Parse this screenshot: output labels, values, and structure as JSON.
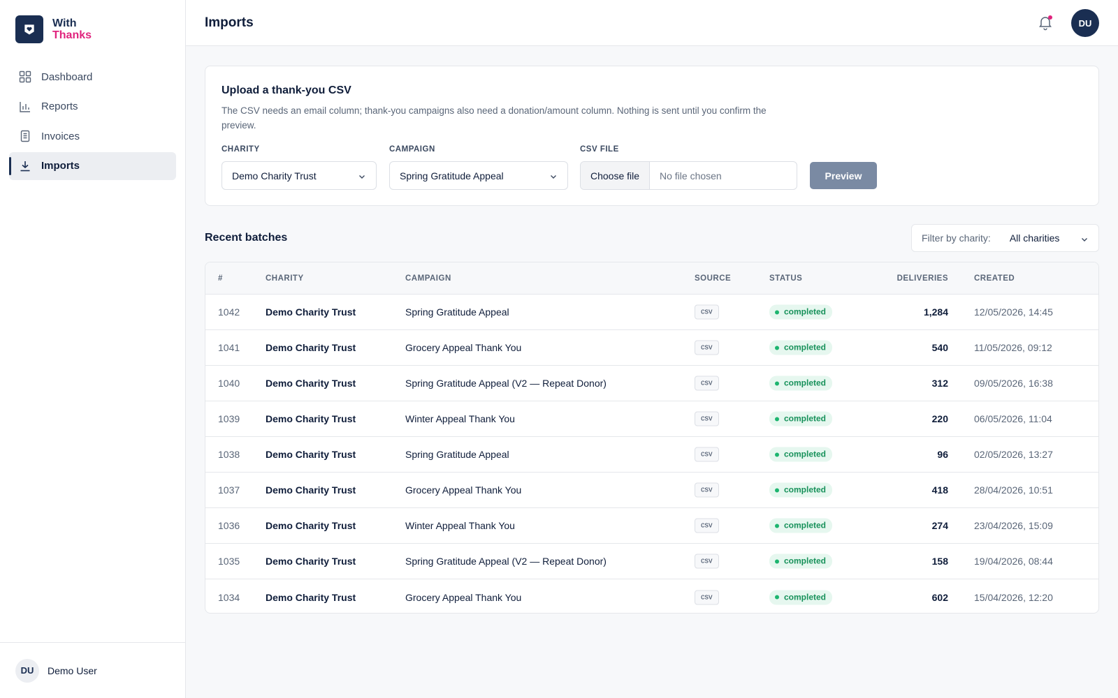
{
  "brand": {
    "line1": "With",
    "line2": "Thanks",
    "icon": "heart-icon"
  },
  "sidebar": {
    "items": [
      {
        "label": "Dashboard",
        "icon": "grid-icon",
        "active": false
      },
      {
        "label": "Reports",
        "icon": "bar-chart-icon",
        "active": false
      },
      {
        "label": "Invoices",
        "icon": "document-icon",
        "active": false
      },
      {
        "label": "Imports",
        "icon": "download-icon",
        "active": true
      }
    ],
    "user": {
      "initials": "DU",
      "name": "Demo User"
    }
  },
  "header": {
    "title": "Imports",
    "avatar_initials": "DU"
  },
  "upload": {
    "title": "Upload a thank-you CSV",
    "description": "The CSV needs an email column; thank-you campaigns also need a donation/amount column. Nothing is sent until you confirm the preview.",
    "charity_label": "CHARITY",
    "charity_value": "Demo Charity Trust",
    "campaign_label": "CAMPAIGN",
    "campaign_value": "Spring Gratitude Appeal",
    "file_label": "CSV FILE",
    "file_button": "Choose file",
    "file_status": "No file chosen",
    "preview_button": "Preview"
  },
  "batches": {
    "title": "Recent batches",
    "filter_label": "Filter by charity:",
    "filter_value": "All charities",
    "columns": {
      "id": "#",
      "charity": "CHARITY",
      "campaign": "CAMPAIGN",
      "source": "SOURCE",
      "status": "STATUS",
      "deliveries": "DELIVERIES",
      "created": "CREATED"
    },
    "rows": [
      {
        "id": "1042",
        "charity": "Demo Charity Trust",
        "campaign": "Spring Gratitude Appeal",
        "source": "csv",
        "status": "completed",
        "deliveries": "1,284",
        "created": "12/05/2026, 14:45"
      },
      {
        "id": "1041",
        "charity": "Demo Charity Trust",
        "campaign": "Grocery Appeal Thank You",
        "source": "csv",
        "status": "completed",
        "deliveries": "540",
        "created": "11/05/2026, 09:12"
      },
      {
        "id": "1040",
        "charity": "Demo Charity Trust",
        "campaign": "Spring Gratitude Appeal (V2 — Repeat Donor)",
        "source": "csv",
        "status": "completed",
        "deliveries": "312",
        "created": "09/05/2026, 16:38"
      },
      {
        "id": "1039",
        "charity": "Demo Charity Trust",
        "campaign": "Winter Appeal Thank You",
        "source": "csv",
        "status": "completed",
        "deliveries": "220",
        "created": "06/05/2026, 11:04"
      },
      {
        "id": "1038",
        "charity": "Demo Charity Trust",
        "campaign": "Spring Gratitude Appeal",
        "source": "csv",
        "status": "completed",
        "deliveries": "96",
        "created": "02/05/2026, 13:27"
      },
      {
        "id": "1037",
        "charity": "Demo Charity Trust",
        "campaign": "Grocery Appeal Thank You",
        "source": "csv",
        "status": "completed",
        "deliveries": "418",
        "created": "28/04/2026, 10:51"
      },
      {
        "id": "1036",
        "charity": "Demo Charity Trust",
        "campaign": "Winter Appeal Thank You",
        "source": "csv",
        "status": "completed",
        "deliveries": "274",
        "created": "23/04/2026, 15:09"
      },
      {
        "id": "1035",
        "charity": "Demo Charity Trust",
        "campaign": "Spring Gratitude Appeal (V2 — Repeat Donor)",
        "source": "csv",
        "status": "completed",
        "deliveries": "158",
        "created": "19/04/2026, 08:44"
      },
      {
        "id": "1034",
        "charity": "Demo Charity Trust",
        "campaign": "Grocery Appeal Thank You",
        "source": "csv",
        "status": "completed",
        "deliveries": "602",
        "created": "15/04/2026, 12:20"
      }
    ]
  },
  "colors": {
    "brand_navy": "#1a2e52",
    "brand_pink": "#e0237d",
    "status_green": "#17915a",
    "preview_button": "#7a8aa3"
  }
}
